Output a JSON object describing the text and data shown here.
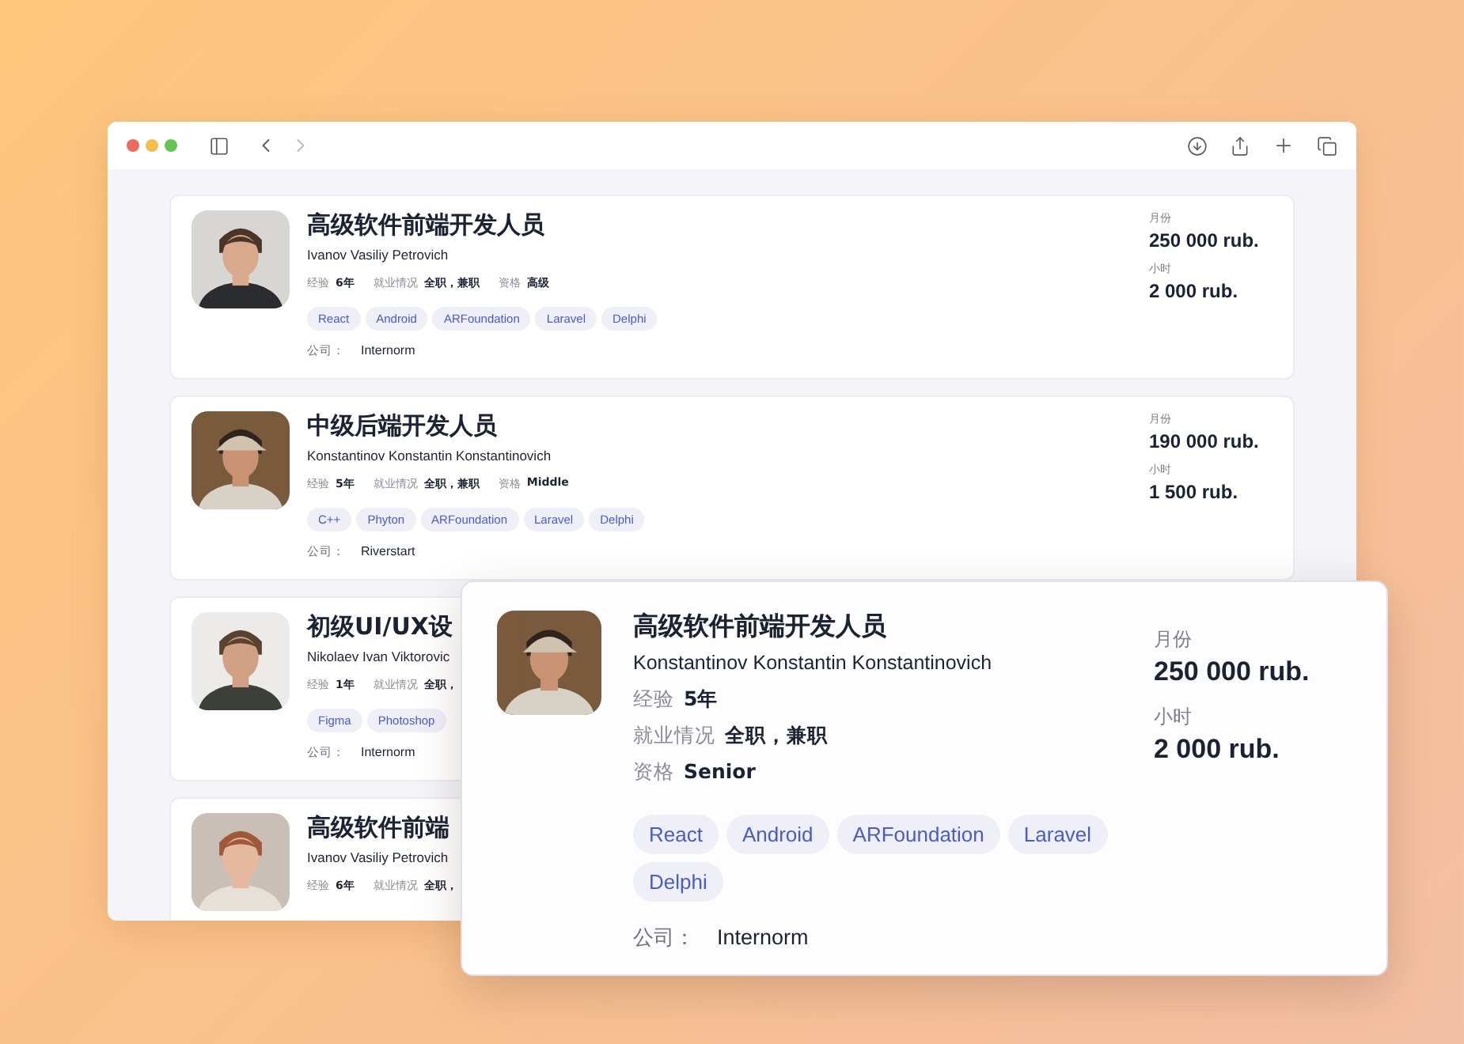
{
  "candidates": [
    {
      "title": "高级软件前端开发人员",
      "name": "Ivanov Vasiliy Petrovich",
      "meta": [
        {
          "label": "经验",
          "value": "6年"
        },
        {
          "label": "就业情况",
          "value": "全职，兼职"
        },
        {
          "label": "资格",
          "value": "高级"
        }
      ],
      "tags": [
        "React",
        "Android",
        "ARFoundation",
        "Laravel",
        "Delphi"
      ],
      "company_label": "公司：",
      "company": "Internorm",
      "salary": [
        {
          "label": "月份",
          "value": "250 000 rub."
        },
        {
          "label": "小时",
          "value": "2 000 rub."
        }
      ]
    },
    {
      "title": "中级后端开发人员",
      "name": "Konstantinov Konstantin Konstantinovich",
      "meta": [
        {
          "label": "经验",
          "value": "5年"
        },
        {
          "label": "就业情况",
          "value": "全职，兼职"
        },
        {
          "label": "资格",
          "value": "Middle"
        }
      ],
      "tags": [
        "C++",
        "Phyton",
        "ARFoundation",
        "Laravel",
        "Delphi"
      ],
      "company_label": "公司：",
      "company": "Riverstart",
      "salary": [
        {
          "label": "月份",
          "value": "190 000 rub."
        },
        {
          "label": "小时",
          "value": "1 500 rub."
        }
      ]
    },
    {
      "title": "初级UI/UX设",
      "name": "Nikolaev Ivan Viktorovic",
      "meta": [
        {
          "label": "经验",
          "value": "1年"
        },
        {
          "label": "就业情况",
          "value": "全职，"
        }
      ],
      "tags": [
        "Figma",
        "Photoshop"
      ],
      "company_label": "公司：",
      "company": "Internorm"
    },
    {
      "title": "高级软件前端",
      "name": "Ivanov Vasiliy Petrovich",
      "meta": [
        {
          "label": "经验",
          "value": "6年"
        },
        {
          "label": "就业情况",
          "value": "全职，"
        }
      ]
    }
  ],
  "popup": {
    "title": "高级软件前端开发人员",
    "name": "Konstantinov Konstantin Konstantinovich",
    "meta": [
      {
        "label": "经验",
        "value": "5年"
      },
      {
        "label": "就业情况",
        "value": "全职，兼职"
      },
      {
        "label": "资格",
        "value": "Senior"
      }
    ],
    "tags": [
      "React",
      "Android",
      "ARFoundation",
      "Laravel",
      "Delphi"
    ],
    "company_label": "公司：",
    "company": "Internorm",
    "salary": [
      {
        "label": "月份",
        "value": "250 000 rub."
      },
      {
        "label": "小时",
        "value": "2 000 rub."
      }
    ]
  }
}
